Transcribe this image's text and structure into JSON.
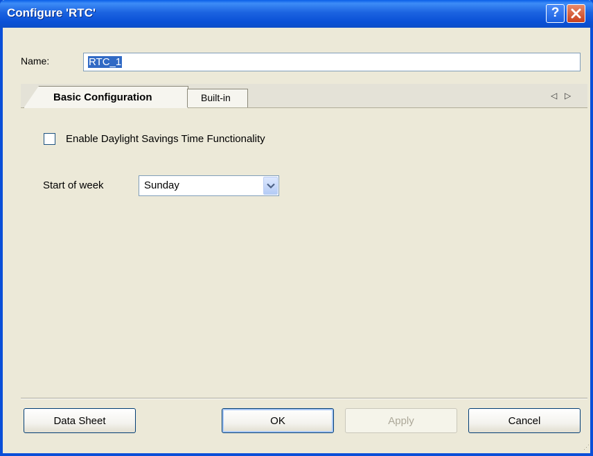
{
  "window": {
    "title": "Configure 'RTC'",
    "help_label": "?"
  },
  "name_field": {
    "label": "Name:",
    "value": "RTC_1"
  },
  "tabs": [
    {
      "label": "Basic Configuration",
      "active": true
    },
    {
      "label": "Built-in",
      "active": false
    }
  ],
  "tab_scroll": {
    "left": "◁",
    "right": "▷"
  },
  "basic": {
    "daylight_label": "Enable Daylight Savings Time Functionality",
    "daylight_checked": false,
    "start_of_week_label": "Start of week",
    "start_of_week_value": "Sunday"
  },
  "buttons": {
    "data_sheet": "Data Sheet",
    "ok": "OK",
    "apply": "Apply",
    "cancel": "Cancel"
  },
  "colors": {
    "titlebar": "#0a50d6",
    "window_bg": "#ece9d8",
    "selection": "#316ac5"
  }
}
